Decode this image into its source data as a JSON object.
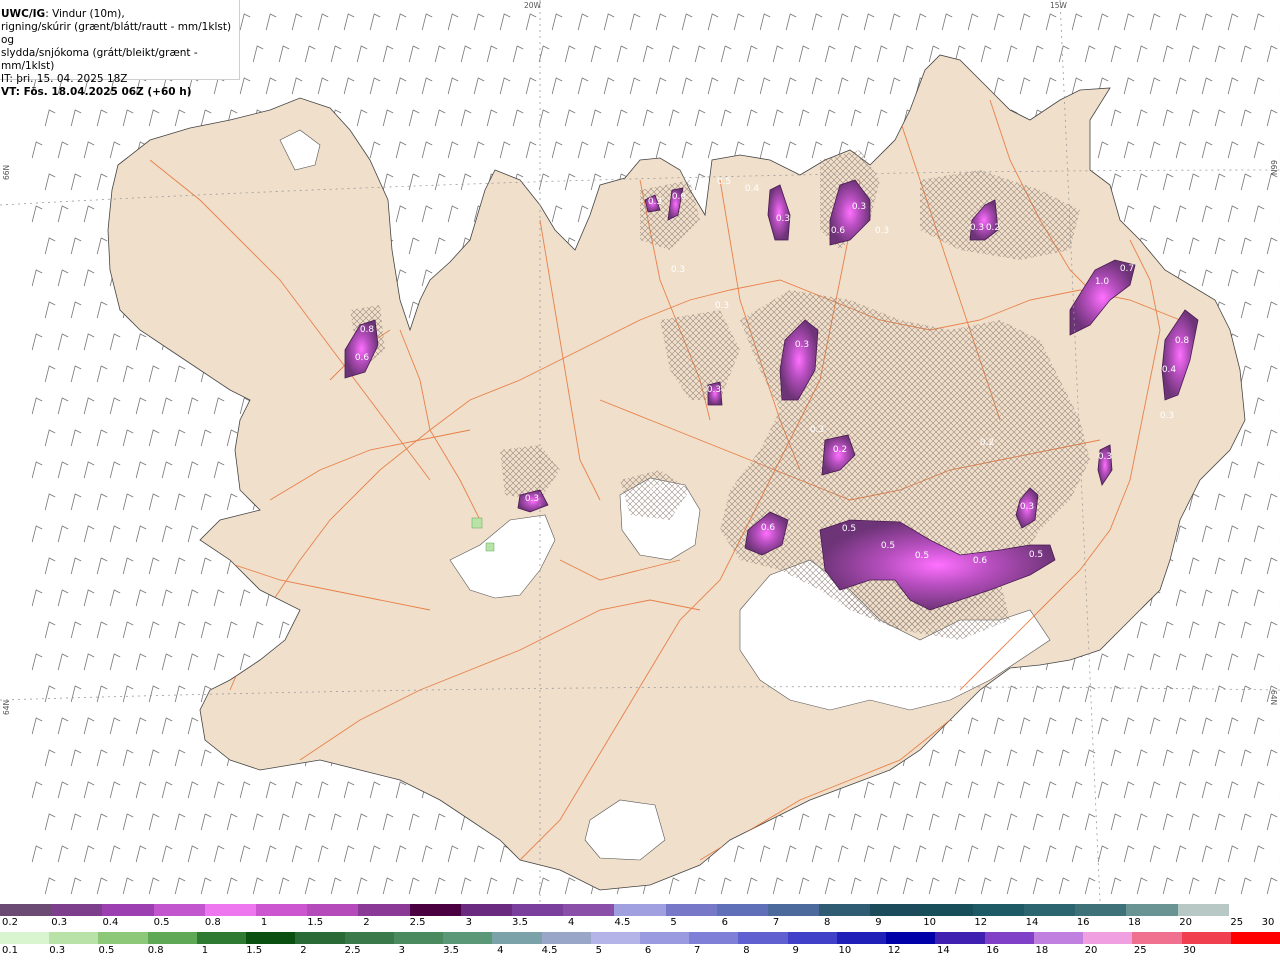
{
  "header": {
    "title_bold": "UWC/IG",
    "line1_rest": ": Vindur (10m),",
    "line2": "rigning/skúrir (grænt/blátt/rautt - mm/1klst) og",
    "line3": "slydda/snjókoma (grátt/bleikt/grænt - mm/1klst)",
    "line4": "IT: þri. 15. 04. 2025 18Z",
    "line5": "VT: Fös. 18.04.2025 06Z (+60 h)"
  },
  "grid_labels": {
    "top_20w": "20W",
    "top_15w": "15W",
    "left_66n": "66N",
    "left_64n": "64N",
    "right_66n": "66N",
    "right_64n": "64N"
  },
  "colors": {
    "land": "#f0dfca",
    "sea": "#ffffff",
    "roads": "#e8763c",
    "wind_barbs": "#777777",
    "snow_core": "#ff70ff",
    "snow_mid": "#b84fc0",
    "snow_edge": "#6e3478"
  },
  "precip_labels": [
    "0.8",
    "0.6",
    "0.3",
    "0.3",
    "0.3",
    "0.3",
    "0.6",
    "0.5",
    "0.4",
    "0.3",
    "0.3",
    "0.6",
    "0.3",
    "0.3",
    "0.3",
    "0.2",
    "0.3",
    "0.2",
    "0.3",
    "0.7",
    "0.6",
    "0.5",
    "0.5",
    "0.5",
    "0.6",
    "0.3",
    "0.5",
    "1.0",
    "0.7",
    "0.8",
    "0.4",
    "0.3",
    "0.3",
    "0.2"
  ],
  "snow_scale": {
    "colors": [
      "#6b4a74",
      "#7d3f8c",
      "#9c3fb0",
      "#c156cf",
      "#ee77f0",
      "#cc55d0",
      "#b54abb",
      "#8a3a96",
      "#4a0040",
      "#6a2a80",
      "#7a3f9c",
      "#8a4fa8",
      "#a0a0e0",
      "#7878c8",
      "#6070b8",
      "#4c6a9c",
      "#2f5c72",
      "#1c4c5c",
      "#184e5a",
      "#1e5a66",
      "#2c6470",
      "#3e7278",
      "#6a9494",
      "#b8c8c4",
      "#ffffff"
    ],
    "ticks": [
      "0.2",
      "0.3",
      "0.4",
      "0.5",
      "0.8",
      "1",
      "1.5",
      "2",
      "2.5",
      "3",
      "3.5",
      "4",
      "4.5",
      "5",
      "6",
      "7",
      "8",
      "9",
      "10",
      "12",
      "14",
      "16",
      "18",
      "20",
      "25",
      "30"
    ]
  },
  "rain_scale": {
    "colors": [
      "#d8f5d0",
      "#b8e2a8",
      "#8cc878",
      "#5ea856",
      "#2e7a32",
      "#0a5010",
      "#2a6a36",
      "#3a7a4a",
      "#4a8a5e",
      "#5a9878",
      "#7aa2a8",
      "#9aa6c8",
      "#b4b4e8",
      "#9a9ae0",
      "#7f7fd8",
      "#6060d0",
      "#4040c8",
      "#2020b8",
      "#0000a8",
      "#4020b0",
      "#8040c8",
      "#c080e0",
      "#f0a0e0",
      "#f07090",
      "#f04050",
      "#ff0000"
    ],
    "ticks": [
      "0.1",
      "0.3",
      "0.5",
      "0.8",
      "1",
      "1.5",
      "2",
      "2.5",
      "3",
      "3.5",
      "4",
      "4.5",
      "5",
      "6",
      "7",
      "8",
      "9",
      "10",
      "12",
      "14",
      "16",
      "18",
      "20",
      "25",
      "30"
    ]
  }
}
